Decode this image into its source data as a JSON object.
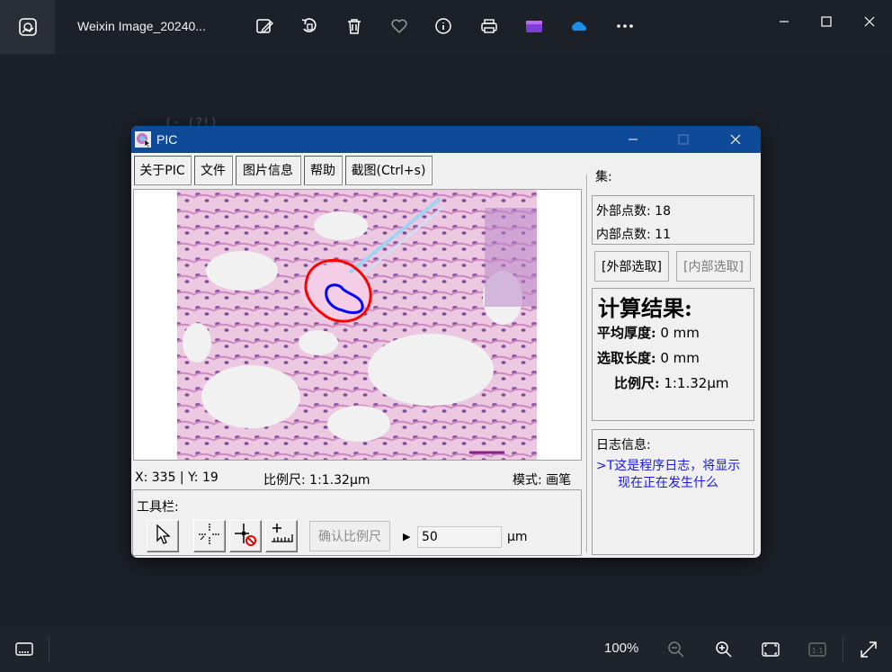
{
  "viewer": {
    "file_title": "Weixin Image_20240...",
    "zoom_level": "100%",
    "background_code": "(·      (?!)"
  },
  "pic": {
    "title": "PIC",
    "menu": [
      "关于PIC",
      "文件",
      "图片信息",
      "帮助",
      "截图(Ctrl+s)"
    ],
    "status": {
      "coords": "X: 335 | Y: 19",
      "scale": "比例尺: 1:1.32μm",
      "mode": "模式:  画笔"
    },
    "toolbar": {
      "label": "工具栏:",
      "confirm_scale": "确认比例尺",
      "play_mark": "▶",
      "scale_value": "50",
      "unit": "μm"
    },
    "side": {
      "set_label": "集:",
      "outer_points": "外部点数: 18",
      "inner_points": "内部点数: 11",
      "outer_select": "[外部选取]",
      "inner_select": "[内部选取]",
      "result_title": "计算结果:",
      "avg_thickness_label": "平均厚度:",
      "avg_thickness_value": "0 mm",
      "select_length_label": "选取长度:",
      "select_length_value": "0 mm",
      "scale_label": "比例尺:",
      "scale_value": "1:1.32μm",
      "log_title": "日志信息:",
      "log_line1": ">T这是程序日志，将显示",
      "log_line2": "现在正在发生什么"
    }
  },
  "colors": {
    "titlebar": "#0f4a98",
    "outer_contour": "#ff0000",
    "inner_contour": "#0000ff",
    "log_text": "#1a1ae0",
    "tissue_pink": "#e9b4d8",
    "nuclei_purple": "#6a2d8c"
  },
  "icons": [
    "photos-app-icon",
    "edit-image-icon",
    "rotate-icon",
    "delete-icon",
    "favorite-icon",
    "info-icon",
    "print-icon",
    "clipchamp-icon",
    "onedrive-icon",
    "more-icon",
    "minimize-icon",
    "maximize-icon",
    "close-icon",
    "filmstrip-icon",
    "zoom-out-icon",
    "zoom-in-icon",
    "fit-window-icon",
    "actual-size-icon",
    "fullscreen-icon",
    "pointer-tool-icon",
    "crosshair-tool-icon",
    "delete-point-tool-icon",
    "ruler-tool-icon"
  ]
}
